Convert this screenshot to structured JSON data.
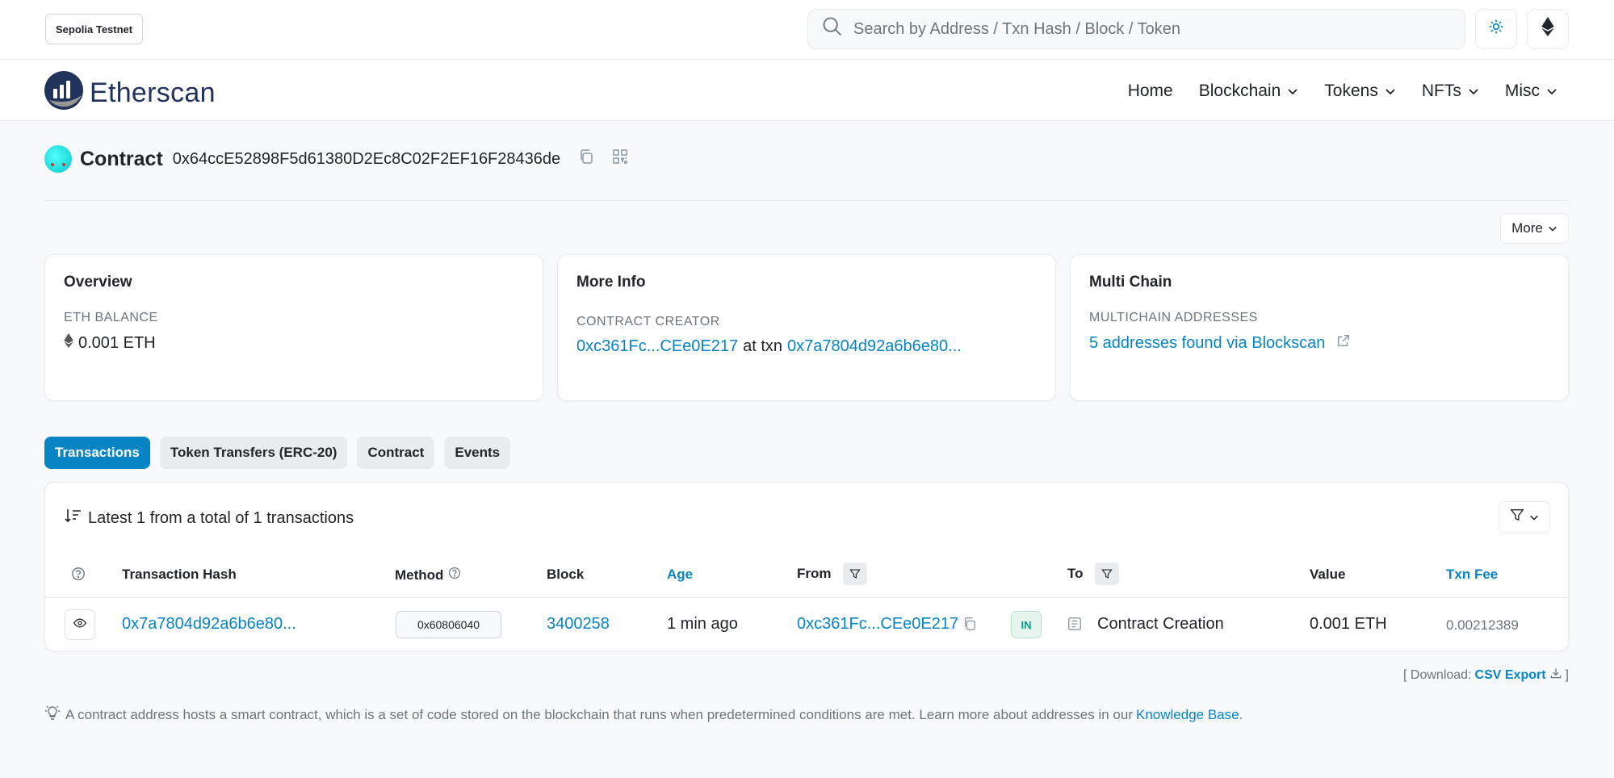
{
  "topbar": {
    "network": "Sepolia Testnet",
    "search_placeholder": "Search by Address / Txn Hash / Block / Token"
  },
  "nav": {
    "logo": "Etherscan",
    "items": [
      "Home",
      "Blockchain",
      "Tokens",
      "NFTs",
      "Misc"
    ]
  },
  "header": {
    "title": "Contract",
    "address": "0x64ccE52898F5d61380D2Ec8C02F2EF16F28436de",
    "more_label": "More"
  },
  "overview": {
    "title": "Overview",
    "balance_label": "ETH BALANCE",
    "balance_value": "0.001 ETH"
  },
  "more_info": {
    "title": "More Info",
    "creator_label": "CONTRACT CREATOR",
    "creator": "0xc361Fc...CEe0E217",
    "at_txn": "at txn",
    "txn": "0x7a7804d92a6b6e80..."
  },
  "multichain": {
    "title": "Multi Chain",
    "label": "MULTICHAIN ADDRESSES",
    "link": "5 addresses found via Blockscan"
  },
  "tabs": [
    "Transactions",
    "Token Transfers (ERC-20)",
    "Contract",
    "Events"
  ],
  "table": {
    "summary": "Latest 1 from a total of 1 transactions",
    "headers": {
      "hash": "Transaction Hash",
      "method": "Method",
      "block": "Block",
      "age": "Age",
      "from": "From",
      "to": "To",
      "value": "Value",
      "fee": "Txn Fee"
    },
    "rows": [
      {
        "hash": "0x7a7804d92a6b6e80...",
        "method": "0x60806040",
        "block": "3400258",
        "age": "1 min ago",
        "from": "0xc361Fc...CEe0E217",
        "direction": "IN",
        "to": "Contract Creation",
        "value": "0.001 ETH",
        "fee": "0.00212389"
      }
    ]
  },
  "download": {
    "prefix": "[ Download:",
    "link": "CSV Export",
    "suffix": "]"
  },
  "footer": {
    "note": "A contract address hosts a smart contract, which is a set of code stored on the blockchain that runs when predetermined conditions are met. Learn more about addresses in our",
    "link": "Knowledge Base",
    "end": "."
  },
  "colors": {
    "accent": "#0784c3",
    "logo": "#21325b",
    "in_badge": "#00a186"
  }
}
